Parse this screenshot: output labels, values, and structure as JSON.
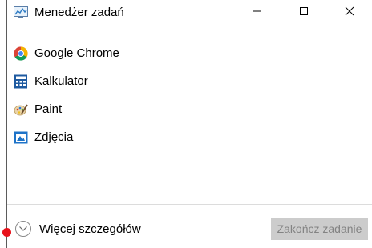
{
  "window": {
    "title": "Menedżer zadań",
    "title_icon": "task-manager-icon",
    "caption_buttons": [
      "minimize-icon",
      "maximize-icon",
      "close-icon"
    ]
  },
  "apps": [
    {
      "label": "Google Chrome",
      "icon": "chrome-icon"
    },
    {
      "label": "Kalkulator",
      "icon": "calculator-icon"
    },
    {
      "label": "Paint",
      "icon": "paint-icon"
    },
    {
      "label": "Zdjęcia",
      "icon": "photos-icon"
    }
  ],
  "footer": {
    "more_details_label": "Więcej szczegółów",
    "end_task_label": "Zakończ zadanie"
  },
  "colors": {
    "accent": "#0078d7",
    "chrome_red": "#db4437",
    "chrome_yellow": "#f4b400",
    "chrome_green": "#0f9d58",
    "disabled_button": "#cccccc",
    "cursor_marker": "#e8121b"
  }
}
